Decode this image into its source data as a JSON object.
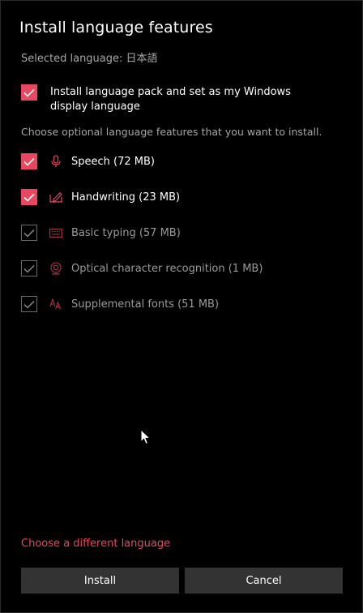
{
  "dialog": {
    "title": "Install language features",
    "selected_language": "Selected language: 日本語",
    "main_option": {
      "label": "Install language pack and set as my Windows display language",
      "checked": true
    },
    "choose_text": "Choose optional language features that you want to install.",
    "features": [
      {
        "label": "Speech (72 MB)",
        "icon": "microphone-icon",
        "checked": true,
        "enabled": true
      },
      {
        "label": "Handwriting (23 MB)",
        "icon": "handwriting-icon",
        "checked": true,
        "enabled": true
      },
      {
        "label": "Basic typing (57 MB)",
        "icon": "keyboard-icon",
        "checked": true,
        "enabled": false
      },
      {
        "label": "Optical character recognition (1 MB)",
        "icon": "ocr-icon",
        "checked": true,
        "enabled": false
      },
      {
        "label": "Supplemental fonts (51 MB)",
        "icon": "font-icon",
        "checked": true,
        "enabled": false
      }
    ],
    "different_language_link": "Choose a different language",
    "install_label": "Install",
    "cancel_label": "Cancel"
  },
  "colors": {
    "accent": "#e8475f",
    "background": "#000000",
    "button": "#333333",
    "muted_text": "#a6a6a6"
  }
}
